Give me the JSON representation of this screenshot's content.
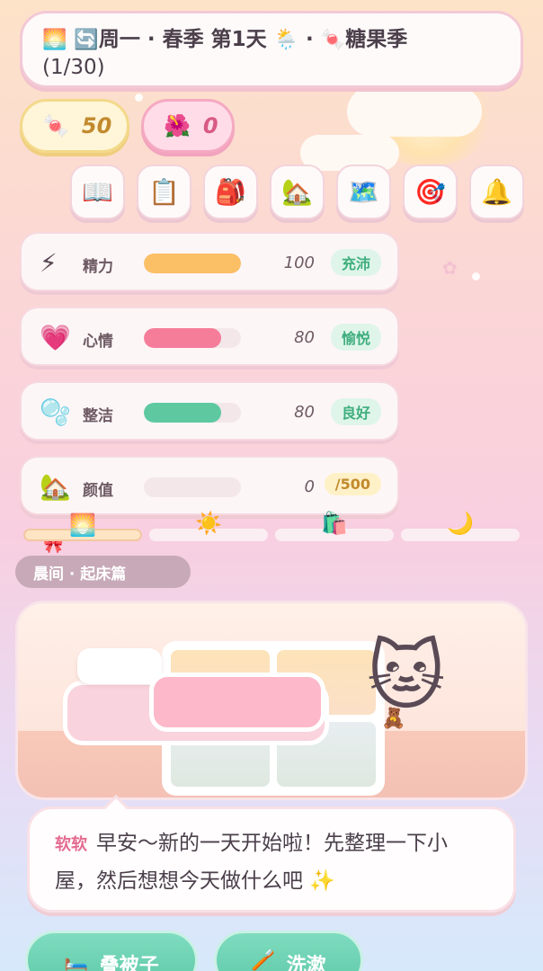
{
  "header": {
    "weather_icon": "sunrise-icon",
    "day_cycle_icon": "cycle-arrows-icon",
    "weekday": "周一",
    "season_day": "春季 第1天",
    "weather": "rain-cloud-icon",
    "event": "糖果季",
    "progress": "(1/30)"
  },
  "currency": {
    "candy": "50",
    "flower": "0"
  },
  "toolbar": [
    {
      "icon": "📖",
      "name": "book-icon"
    },
    {
      "icon": "📋",
      "name": "clipboard-icon"
    },
    {
      "icon": "🎒",
      "name": "backpack-icon"
    },
    {
      "icon": "🏡",
      "name": "house-icon"
    },
    {
      "icon": "🗺️",
      "name": "map-icon"
    },
    {
      "icon": "🎯",
      "name": "target-icon"
    },
    {
      "icon": "🔔",
      "name": "bell-icon"
    }
  ],
  "stats": [
    {
      "icon": "⚡",
      "label": "精力",
      "value": "100",
      "badge": "充沛",
      "percent": 100,
      "color": "#fbbf66",
      "badge_bg": "#dff5ea",
      "badge_color": "#3fae7d"
    },
    {
      "icon": "💗",
      "label": "心情",
      "value": "80",
      "badge": "愉悦",
      "percent": 80,
      "color": "#f57d9a",
      "badge_bg": "#dff5ea",
      "badge_color": "#3fae7d"
    },
    {
      "icon": "🫧",
      "label": "整洁",
      "value": "80",
      "badge": "良好",
      "percent": 80,
      "color": "#5ec9a0",
      "badge_bg": "#dff5ea",
      "badge_color": "#3fae7d"
    },
    {
      "icon": "🏡",
      "label": "颜值",
      "value": "0",
      "badge": "/500",
      "percent": 0,
      "color": "#f0c6d2",
      "badge_bg": "#fff1c7",
      "badge_color": "#c28a2e"
    }
  ],
  "timeline": [
    {
      "icon": "🌅",
      "name": "morning-icon",
      "active": true
    },
    {
      "icon": "☀️",
      "name": "sun-icon",
      "active": false
    },
    {
      "icon": "🛍️",
      "name": "shopping-bag-icon",
      "active": false
    },
    {
      "icon": "🌙",
      "name": "moon-icon",
      "active": false
    }
  ],
  "scene": {
    "tag": "晨间 · 起床篇"
  },
  "dialog": {
    "speaker": "软软",
    "text": "早安～新的一天开始啦！先整理一下小屋，然后想想今天做什么吧 ✨"
  },
  "actions": [
    {
      "icon": "🛏️",
      "label": "叠被子"
    },
    {
      "icon": "🪥",
      "label": "洗漱"
    }
  ]
}
